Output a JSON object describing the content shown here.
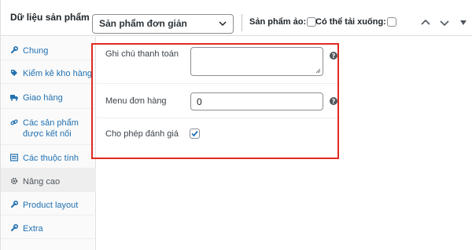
{
  "header": {
    "title": "Dữ liệu sản phẩm —",
    "product_type": "Sản phẩm đơn giản",
    "virtual_label": "Sản phẩm ảo:",
    "downloadable_label": "Có thể tải xuống:"
  },
  "sidebar": {
    "items": [
      {
        "label": "Chung",
        "icon": "wrench-icon"
      },
      {
        "label": "Kiểm kê kho hàng",
        "icon": "tag-icon"
      },
      {
        "label": "Giao hàng",
        "icon": "truck-icon"
      },
      {
        "label": "Các sản phẩm được kết nối",
        "icon": "link-icon"
      },
      {
        "label": "Các thuộc tính",
        "icon": "list-icon"
      },
      {
        "label": "Nâng cao",
        "icon": "gear-icon"
      },
      {
        "label": "Product layout",
        "icon": "wrench-icon"
      },
      {
        "label": "Extra",
        "icon": "wrench-icon"
      }
    ]
  },
  "form": {
    "purchase_note_label": "Ghi chú thanh toán",
    "purchase_note_value": "",
    "menu_order_label": "Menu đơn hàng",
    "menu_order_value": "0",
    "reviews_label": "Cho phép đánh giá",
    "reviews_checked": true
  },
  "colors": {
    "link": "#2271b1",
    "highlight": "#e02b20"
  }
}
